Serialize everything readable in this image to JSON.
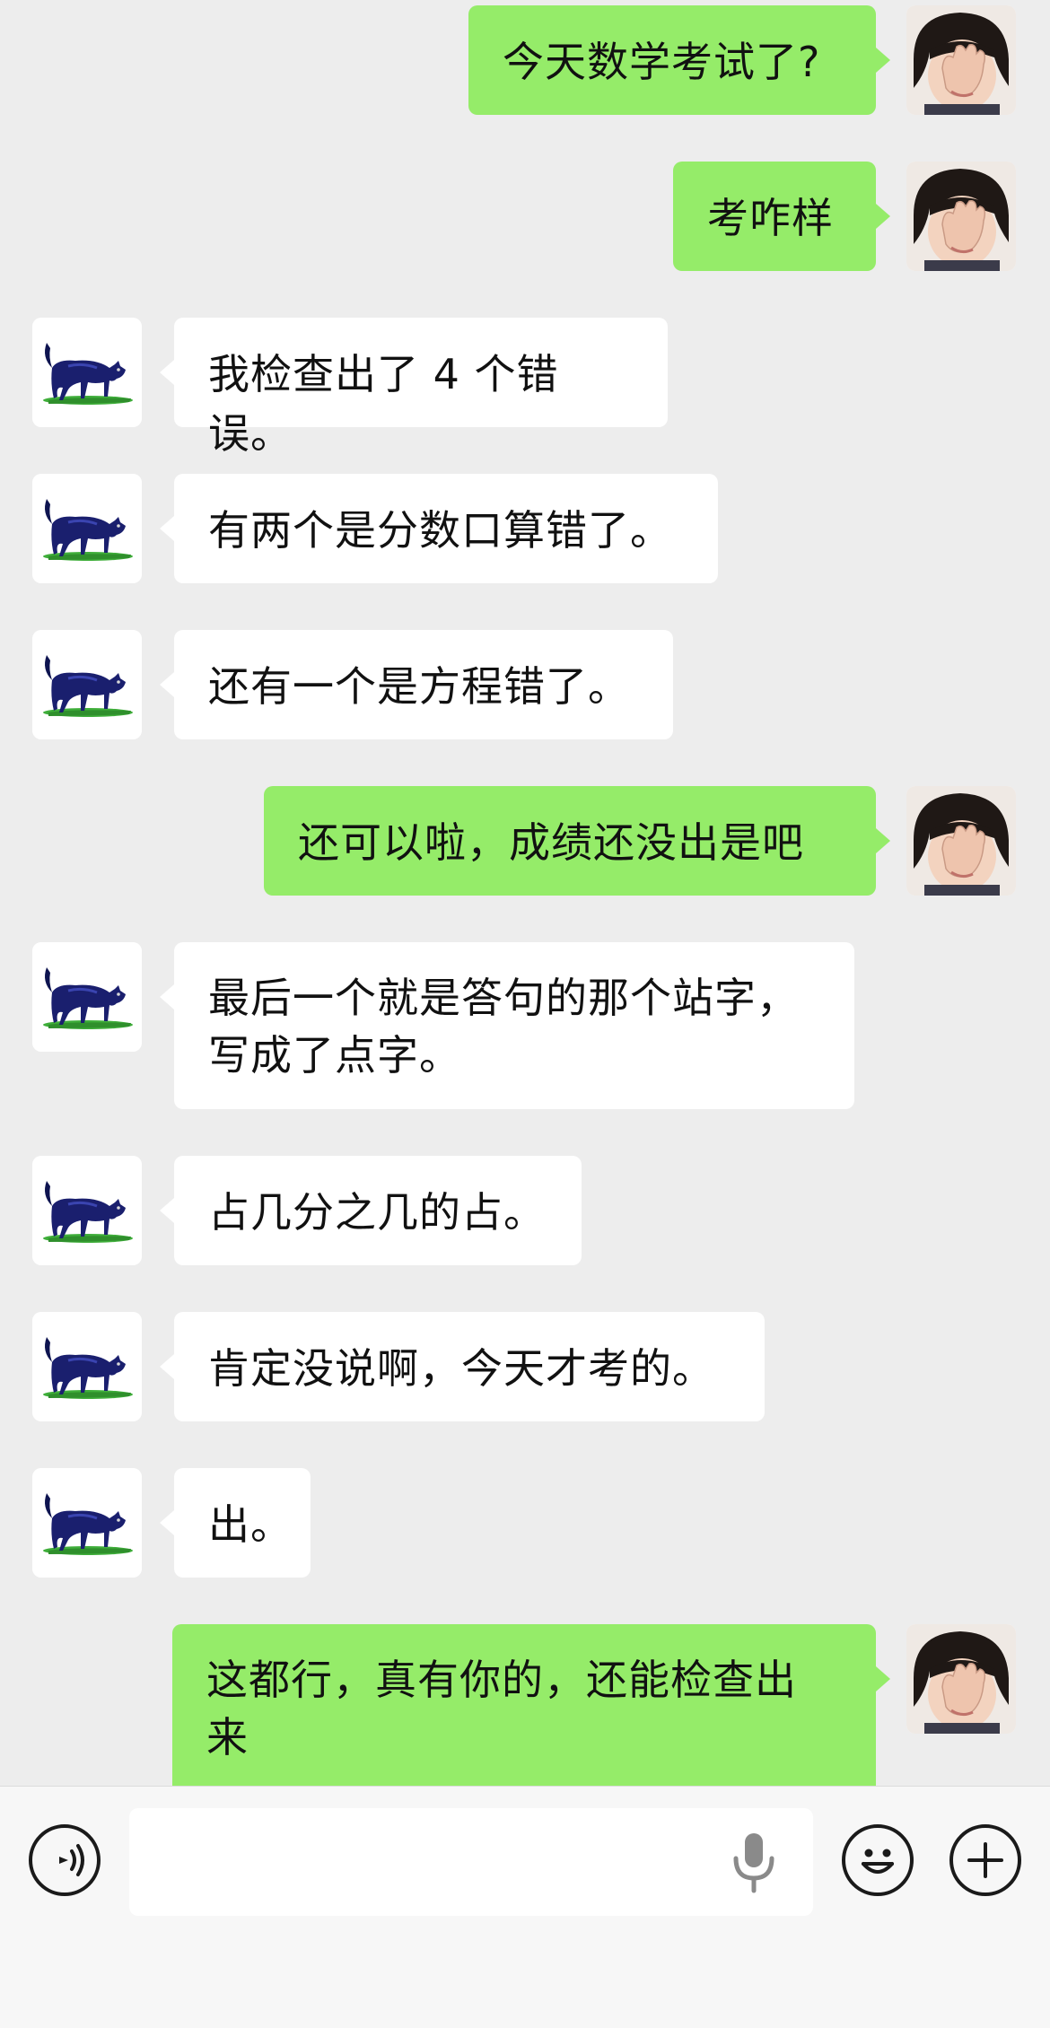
{
  "conversation": {
    "messages": [
      {
        "side": "out",
        "text": "今天数学考试了?"
      },
      {
        "side": "out",
        "text": "考咋样"
      },
      {
        "side": "in",
        "text": "我检查出了 4 个错误。"
      },
      {
        "side": "in",
        "text": "有两个是分数口算错了。"
      },
      {
        "side": "in",
        "text": "还有一个是方程错了。"
      },
      {
        "side": "out",
        "text": "还可以啦，成绩还没出是吧"
      },
      {
        "side": "in",
        "text": "最后一个就是答句的那个站字，\n写成了点字。"
      },
      {
        "side": "in",
        "text": "占几分之几的占。"
      },
      {
        "side": "in",
        "text": "肯定没说啊，今天才考的。"
      },
      {
        "side": "in",
        "text": "出。"
      },
      {
        "side": "out",
        "text": "这都行，真有你的，还能检查出\n来"
      }
    ]
  },
  "toolbar": {
    "voice_icon": "voice-icon",
    "input_value": "",
    "mic_icon": "microphone-icon",
    "emoji_icon": "emoji-icon",
    "plus_icon": "plus-icon"
  },
  "colors": {
    "background": "#ededed",
    "outgoing_bubble": "#95ec69",
    "incoming_bubble": "#ffffff",
    "toolbar": "#f7f7f7"
  }
}
